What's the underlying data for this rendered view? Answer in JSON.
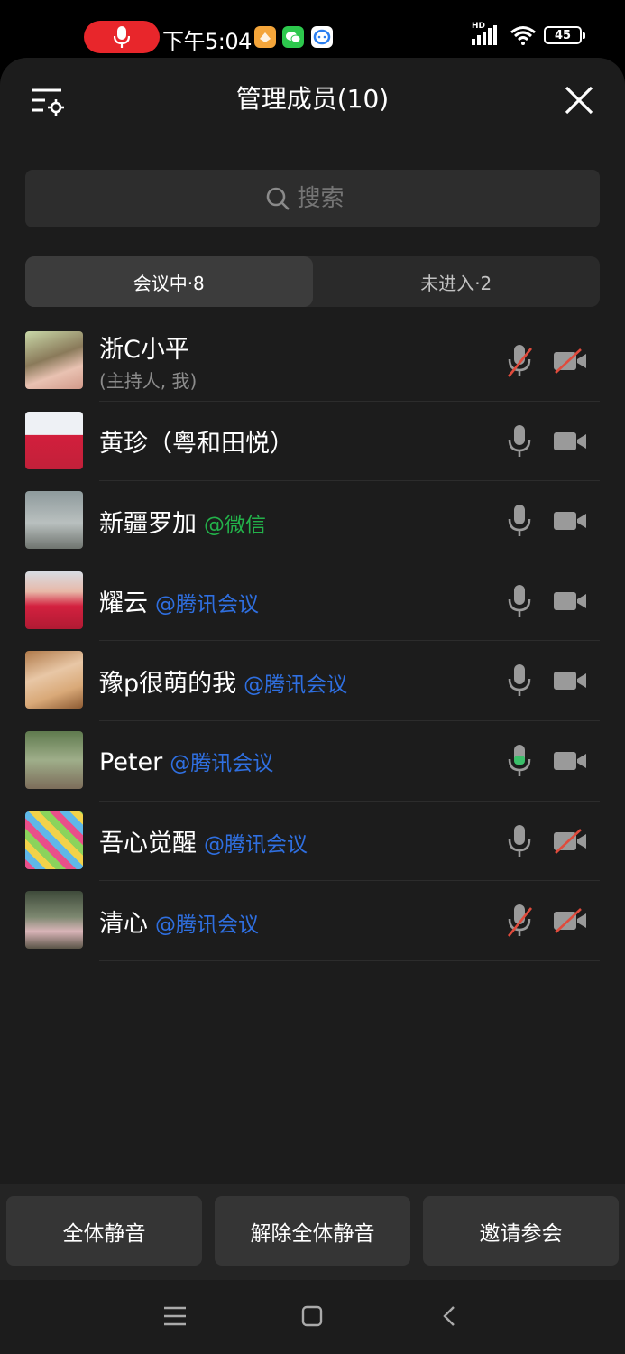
{
  "status_bar": {
    "time": "下午5:04",
    "battery": "45",
    "signal": "HD",
    "recording_icon": "microphone-icon",
    "app_icons": [
      "orange-app-icon",
      "wechat-icon",
      "chat-bubble-icon"
    ]
  },
  "header": {
    "title": "管理成员(10)",
    "manage_icon": "member-settings-icon",
    "close_icon": "close-icon"
  },
  "search": {
    "placeholder": "搜索"
  },
  "tabs": [
    {
      "label": "会议中·8",
      "active": true
    },
    {
      "label": "未进入·2",
      "active": false
    }
  ],
  "members": [
    {
      "name": "浙C小平",
      "tag": "",
      "tag_color": "",
      "subtitle": "(主持人, 我)",
      "mic": "muted",
      "camera": "off"
    },
    {
      "name": "黄珍（粤和田悦）",
      "tag": "",
      "tag_color": "",
      "subtitle": "",
      "mic": "on",
      "camera": "on"
    },
    {
      "name": "新疆罗加",
      "tag": "@微信",
      "tag_color": "#23b24a",
      "subtitle": "",
      "mic": "on",
      "camera": "on"
    },
    {
      "name": "耀云",
      "tag": "@腾讯会议",
      "tag_color": "#2f6fe0",
      "subtitle": "",
      "mic": "on",
      "camera": "on"
    },
    {
      "name": "豫p很萌的我",
      "tag": "@腾讯会议",
      "tag_color": "#2f6fe0",
      "subtitle": "",
      "mic": "on",
      "camera": "on"
    },
    {
      "name": "Peter",
      "tag": "@腾讯会议",
      "tag_color": "#2f6fe0",
      "subtitle": "",
      "mic": "speaking",
      "camera": "on"
    },
    {
      "name": "吾心觉醒",
      "tag": "@腾讯会议",
      "tag_color": "#2f6fe0",
      "subtitle": "",
      "mic": "on",
      "camera": "off"
    },
    {
      "name": "清心",
      "tag": "@腾讯会议",
      "tag_color": "#2f6fe0",
      "subtitle": "",
      "mic": "muted",
      "camera": "off"
    }
  ],
  "actions": {
    "mute_all": "全体静音",
    "unmute_all": "解除全体静音",
    "invite": "邀请参会"
  },
  "navbar": {
    "menu_icon": "menu-icon",
    "home_icon": "home-icon",
    "back_icon": "back-icon"
  },
  "colors": {
    "accent_blue": "#2f6fe0",
    "wechat_green": "#23b24a",
    "muted_red": "#e04b3c",
    "background": "#1c1c1c"
  }
}
